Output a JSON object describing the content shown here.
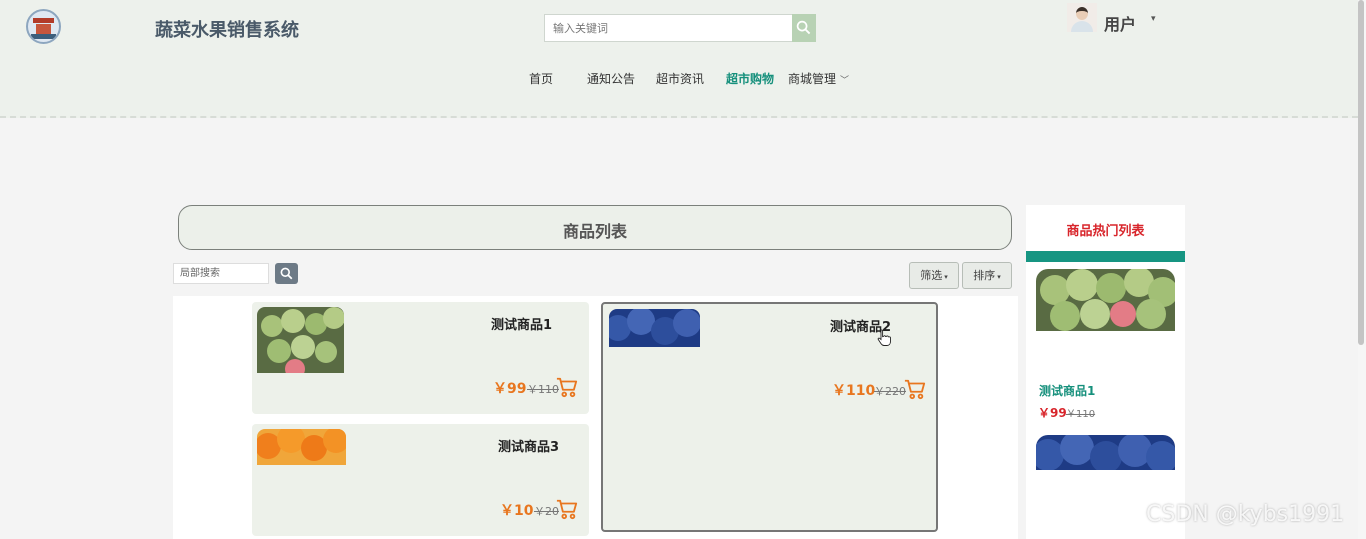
{
  "header": {
    "site_title": "蔬菜水果销售系统",
    "search_placeholder": "输入关键词",
    "user_label": "用户",
    "user_caret": "▾"
  },
  "nav": {
    "items": [
      {
        "label": "首页",
        "active": false
      },
      {
        "label": "通知公告",
        "active": false
      },
      {
        "label": "超市资讯",
        "active": false
      },
      {
        "label": "超市购物",
        "active": true
      },
      {
        "label": "商城管理",
        "active": false,
        "has_dropdown": true
      }
    ],
    "dropdown_caret": "﹀"
  },
  "product_list": {
    "title": "商品列表",
    "local_search_placeholder": "局部搜索",
    "filter_label": "筛选",
    "sort_label": "排序",
    "caret": "▾",
    "products": [
      {
        "name": "测试商品1",
        "price": "￥99",
        "old_price": "￥110",
        "image": "green-fruit",
        "hovered": false
      },
      {
        "name": "测试商品2",
        "price": "￥110",
        "old_price": "￥220",
        "image": "blueberry",
        "hovered": true
      },
      {
        "name": "测试商品3",
        "price": "￥10",
        "old_price": "￥20",
        "image": "orange",
        "hovered": false
      }
    ]
  },
  "sidebar": {
    "title": "商品热门列表",
    "items": [
      {
        "name": "测试商品1",
        "price": "￥99",
        "old_price": "￥110",
        "image": "green-fruit"
      },
      {
        "image": "blueberry"
      }
    ]
  },
  "watermark": "CSDN @kybs1991",
  "colors": {
    "accent": "#16907c",
    "price": "#e8761f",
    "hot_title": "#d8252b",
    "header_bg": "#edf1ec",
    "card_bg": "#edf1ea"
  }
}
